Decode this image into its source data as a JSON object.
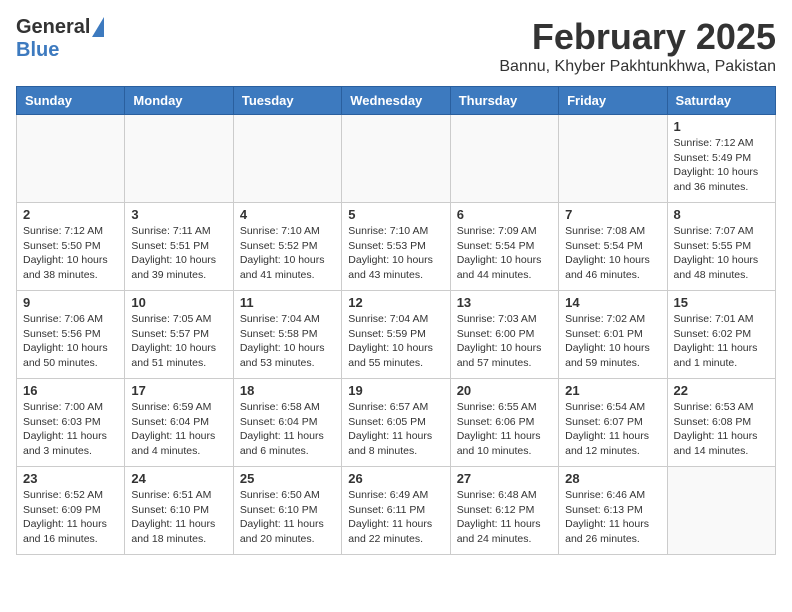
{
  "header": {
    "logo_general": "General",
    "logo_blue": "Blue",
    "month_title": "February 2025",
    "location": "Bannu, Khyber Pakhtunkhwa, Pakistan"
  },
  "weekdays": [
    "Sunday",
    "Monday",
    "Tuesday",
    "Wednesday",
    "Thursday",
    "Friday",
    "Saturday"
  ],
  "weeks": [
    [
      {
        "day": "",
        "empty": true
      },
      {
        "day": "",
        "empty": true
      },
      {
        "day": "",
        "empty": true
      },
      {
        "day": "",
        "empty": true
      },
      {
        "day": "",
        "empty": true
      },
      {
        "day": "",
        "empty": true
      },
      {
        "day": "1",
        "sunrise": "7:12 AM",
        "sunset": "5:49 PM",
        "daylight": "10 hours and 36 minutes."
      }
    ],
    [
      {
        "day": "2",
        "sunrise": "7:12 AM",
        "sunset": "5:50 PM",
        "daylight": "10 hours and 38 minutes."
      },
      {
        "day": "3",
        "sunrise": "7:11 AM",
        "sunset": "5:51 PM",
        "daylight": "10 hours and 39 minutes."
      },
      {
        "day": "4",
        "sunrise": "7:10 AM",
        "sunset": "5:52 PM",
        "daylight": "10 hours and 41 minutes."
      },
      {
        "day": "5",
        "sunrise": "7:10 AM",
        "sunset": "5:53 PM",
        "daylight": "10 hours and 43 minutes."
      },
      {
        "day": "6",
        "sunrise": "7:09 AM",
        "sunset": "5:54 PM",
        "daylight": "10 hours and 44 minutes."
      },
      {
        "day": "7",
        "sunrise": "7:08 AM",
        "sunset": "5:54 PM",
        "daylight": "10 hours and 46 minutes."
      },
      {
        "day": "8",
        "sunrise": "7:07 AM",
        "sunset": "5:55 PM",
        "daylight": "10 hours and 48 minutes."
      }
    ],
    [
      {
        "day": "9",
        "sunrise": "7:06 AM",
        "sunset": "5:56 PM",
        "daylight": "10 hours and 50 minutes."
      },
      {
        "day": "10",
        "sunrise": "7:05 AM",
        "sunset": "5:57 PM",
        "daylight": "10 hours and 51 minutes."
      },
      {
        "day": "11",
        "sunrise": "7:04 AM",
        "sunset": "5:58 PM",
        "daylight": "10 hours and 53 minutes."
      },
      {
        "day": "12",
        "sunrise": "7:04 AM",
        "sunset": "5:59 PM",
        "daylight": "10 hours and 55 minutes."
      },
      {
        "day": "13",
        "sunrise": "7:03 AM",
        "sunset": "6:00 PM",
        "daylight": "10 hours and 57 minutes."
      },
      {
        "day": "14",
        "sunrise": "7:02 AM",
        "sunset": "6:01 PM",
        "daylight": "10 hours and 59 minutes."
      },
      {
        "day": "15",
        "sunrise": "7:01 AM",
        "sunset": "6:02 PM",
        "daylight": "11 hours and 1 minute."
      }
    ],
    [
      {
        "day": "16",
        "sunrise": "7:00 AM",
        "sunset": "6:03 PM",
        "daylight": "11 hours and 3 minutes."
      },
      {
        "day": "17",
        "sunrise": "6:59 AM",
        "sunset": "6:04 PM",
        "daylight": "11 hours and 4 minutes."
      },
      {
        "day": "18",
        "sunrise": "6:58 AM",
        "sunset": "6:04 PM",
        "daylight": "11 hours and 6 minutes."
      },
      {
        "day": "19",
        "sunrise": "6:57 AM",
        "sunset": "6:05 PM",
        "daylight": "11 hours and 8 minutes."
      },
      {
        "day": "20",
        "sunrise": "6:55 AM",
        "sunset": "6:06 PM",
        "daylight": "11 hours and 10 minutes."
      },
      {
        "day": "21",
        "sunrise": "6:54 AM",
        "sunset": "6:07 PM",
        "daylight": "11 hours and 12 minutes."
      },
      {
        "day": "22",
        "sunrise": "6:53 AM",
        "sunset": "6:08 PM",
        "daylight": "11 hours and 14 minutes."
      }
    ],
    [
      {
        "day": "23",
        "sunrise": "6:52 AM",
        "sunset": "6:09 PM",
        "daylight": "11 hours and 16 minutes."
      },
      {
        "day": "24",
        "sunrise": "6:51 AM",
        "sunset": "6:10 PM",
        "daylight": "11 hours and 18 minutes."
      },
      {
        "day": "25",
        "sunrise": "6:50 AM",
        "sunset": "6:10 PM",
        "daylight": "11 hours and 20 minutes."
      },
      {
        "day": "26",
        "sunrise": "6:49 AM",
        "sunset": "6:11 PM",
        "daylight": "11 hours and 22 minutes."
      },
      {
        "day": "27",
        "sunrise": "6:48 AM",
        "sunset": "6:12 PM",
        "daylight": "11 hours and 24 minutes."
      },
      {
        "day": "28",
        "sunrise": "6:46 AM",
        "sunset": "6:13 PM",
        "daylight": "11 hours and 26 minutes."
      },
      {
        "day": "",
        "empty": true
      }
    ]
  ]
}
